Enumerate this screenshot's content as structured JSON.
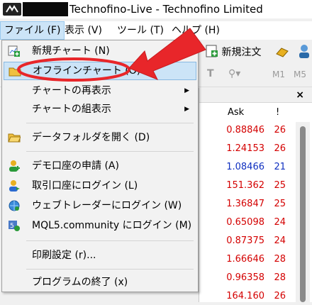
{
  "window": {
    "title": "Technofino-Live - Technofino Limited"
  },
  "menubar": {
    "items": [
      {
        "label": "ファイル (F)"
      },
      {
        "label": "表示 (V)"
      },
      {
        "label": "ツール (T)"
      },
      {
        "label": "ヘルプ (H)"
      }
    ]
  },
  "toolbar": {
    "new_order": "新規注文",
    "m1": "M1",
    "m5": "M5"
  },
  "file_menu": {
    "items": [
      {
        "label": "新規チャート (N)",
        "icon": "new-chart-icon"
      },
      {
        "label": "オフラインチャート (O)",
        "icon": "offline-chart-folder-icon"
      },
      {
        "label": "チャートの再表示",
        "submenu": true
      },
      {
        "label": "チャートの組表示",
        "submenu": true
      },
      {
        "label": "データフォルダを開く (D)",
        "icon": "folder-icon"
      },
      {
        "label": "デモ口座の申請 (A)",
        "icon": "demo-account-icon"
      },
      {
        "label": "取引口座にログイン (L)",
        "icon": "login-icon"
      },
      {
        "label": "ウェブトレーダーにログイン (W)",
        "icon": "webtrader-icon"
      },
      {
        "label": "MQL5.community にログイン (M)",
        "icon": "mql5-icon"
      },
      {
        "label": "印刷設定 (r)..."
      },
      {
        "label": "プログラムの終了 (x)"
      }
    ]
  },
  "market_watch": {
    "close": "×",
    "header_ask": "Ask",
    "header_spread": "!",
    "rows": [
      {
        "ask": "0.88846",
        "spread": "26",
        "color": "#d40000"
      },
      {
        "ask": "1.24153",
        "spread": "26",
        "color": "#d40000"
      },
      {
        "ask": "1.08466",
        "spread": "21",
        "color": "#1030c0"
      },
      {
        "ask": "151.362",
        "spread": "25",
        "color": "#d40000"
      },
      {
        "ask": "1.36847",
        "spread": "25",
        "color": "#d40000"
      },
      {
        "ask": "0.65098",
        "spread": "24",
        "color": "#d40000"
      },
      {
        "ask": "0.87375",
        "spread": "24",
        "color": "#d40000"
      },
      {
        "ask": "1.66646",
        "spread": "28",
        "color": "#d40000"
      },
      {
        "ask": "0.96358",
        "spread": "28",
        "color": "#d40000"
      },
      {
        "ask": "164.160",
        "spread": "26",
        "color": "#d40000"
      }
    ]
  },
  "colors": {
    "highlight": "#cce4f7",
    "annotation": "#e8262a",
    "ask_down": "#d40000",
    "ask_up": "#1030c0"
  }
}
